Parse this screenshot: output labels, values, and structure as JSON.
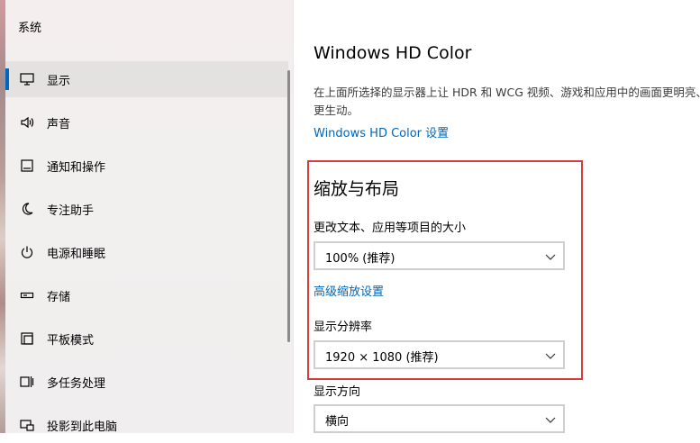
{
  "sidebar": {
    "title": "系统",
    "items": [
      {
        "label": "显示",
        "icon": "monitor-icon"
      },
      {
        "label": "声音",
        "icon": "speaker-icon"
      },
      {
        "label": "通知和操作",
        "icon": "notification-icon"
      },
      {
        "label": "专注助手",
        "icon": "moon-icon"
      },
      {
        "label": "电源和睡眠",
        "icon": "power-icon"
      },
      {
        "label": "存储",
        "icon": "storage-icon"
      },
      {
        "label": "平板模式",
        "icon": "tablet-icon"
      },
      {
        "label": "多任务处理",
        "icon": "multitask-icon"
      },
      {
        "label": "投影到此电脑",
        "icon": "project-icon"
      }
    ]
  },
  "main": {
    "hdr_title": "Windows HD Color",
    "hdr_desc": "在上面所选择的显示器上让 HDR 和 WCG 视频、游戏和应用中的画面更明亮、更生动。",
    "hdr_link": "Windows HD Color 设置",
    "scale_section_title": "缩放与布局",
    "text_size_label": "更改文本、应用等项目的大小",
    "text_size_value": "100% (推荐)",
    "advanced_scale_link": "高级缩放设置",
    "resolution_label": "显示分辨率",
    "resolution_value": "1920 × 1080 (推荐)",
    "orientation_label": "显示方向",
    "orientation_value": "横向"
  },
  "colors": {
    "accent": "#0067c0",
    "link": "#0067b8",
    "highlight_box": "#d93a3a"
  }
}
